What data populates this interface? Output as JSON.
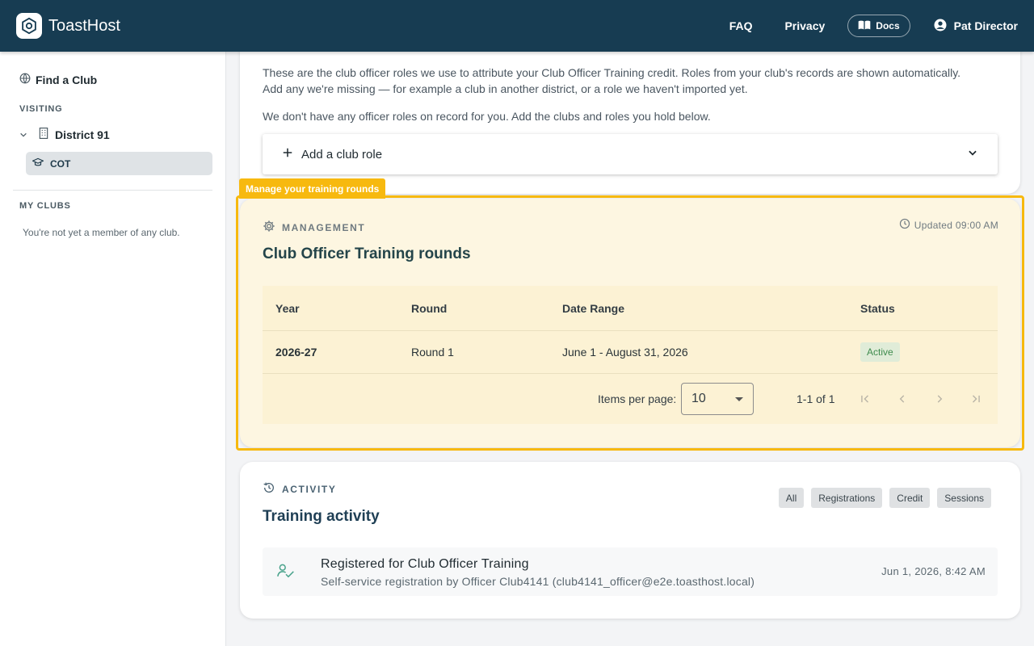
{
  "header": {
    "brand": "ToastHost",
    "nav": {
      "faq": "FAQ",
      "privacy": "Privacy",
      "docs": "Docs"
    },
    "user_name": "Pat Director"
  },
  "sidebar": {
    "find_club": "Find a Club",
    "visiting_label": "VISITING",
    "district": "District 91",
    "cot": "COT",
    "my_clubs_label": "MY CLUBS",
    "my_clubs_empty": "You're not yet a member of any club."
  },
  "roles_card": {
    "intro_line1": "These are the club officer roles we use to attribute your Club Officer Training credit. Roles from your club's records are shown automatically.",
    "intro_line2": "Add any we're missing — for example a club in another district, or a role we haven't imported yet.",
    "no_roles": "We don't have any officer roles on record for you. Add the clubs and roles you hold below.",
    "add_role_label": "Add a club role"
  },
  "highlight": {
    "tag": "Manage your training rounds",
    "color": "#f7b90f"
  },
  "management": {
    "eyebrow": "MANAGEMENT",
    "updated": "Updated 09:00 AM",
    "title": "Club Officer Training rounds",
    "columns": {
      "year": "Year",
      "round": "Round",
      "date_range": "Date Range",
      "status": "Status"
    },
    "rows": [
      {
        "year": "2026-27",
        "round": "Round 1",
        "date_range": "June 1 - August 31, 2026",
        "status": "Active"
      }
    ],
    "paginator": {
      "items_per_page_label": "Items per page:",
      "items_per_page": "10",
      "range": "1-1 of 1"
    }
  },
  "activity": {
    "eyebrow": "ACTIVITY",
    "title": "Training activity",
    "filters": [
      "All",
      "Registrations",
      "Credit",
      "Sessions"
    ],
    "items": [
      {
        "title": "Registered for Club Officer Training",
        "subtitle": "Self-service registration by Officer Club4141 (club4141_officer@e2e.toasthost.local)",
        "time": "Jun 1, 2026, 8:42 AM"
      }
    ]
  },
  "colors": {
    "topbar": "#173c52",
    "management_bg": "#fdf6e1",
    "status_active": "#3f8c4e",
    "activity_icon": "#4aa38c"
  }
}
